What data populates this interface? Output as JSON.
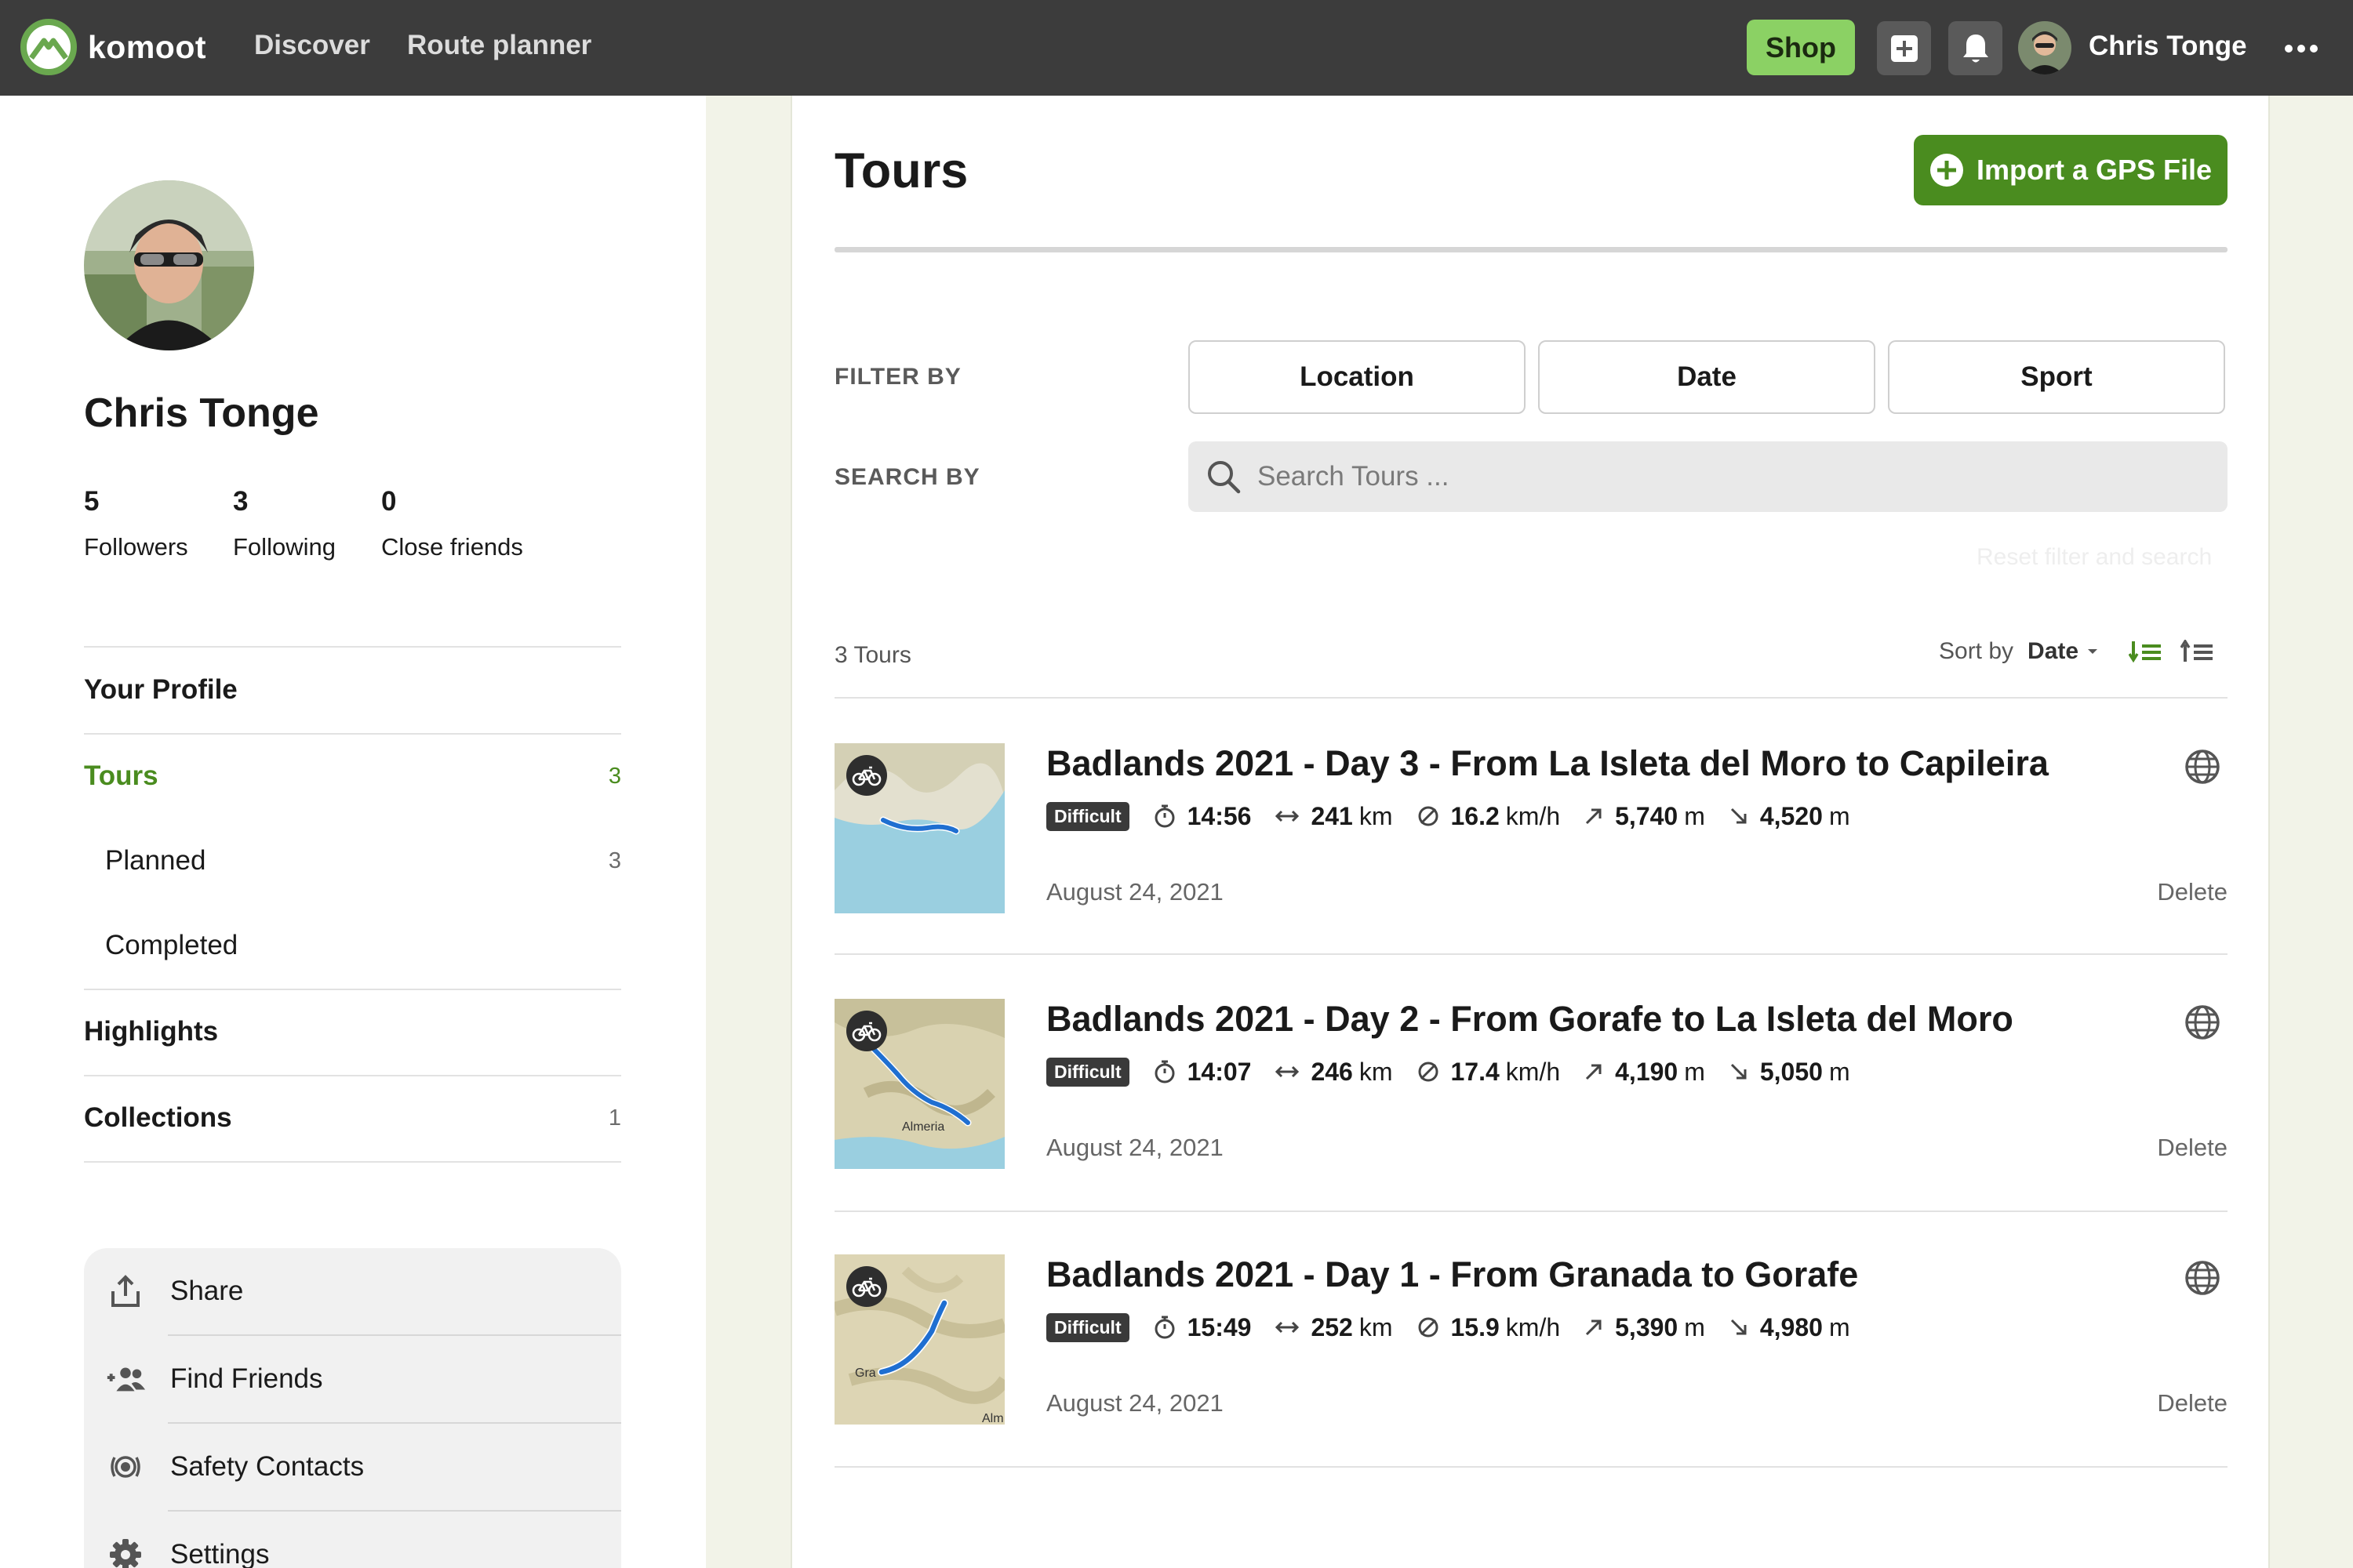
{
  "header": {
    "brand": "komoot",
    "nav": [
      "Discover",
      "Route planner"
    ],
    "shop_label": "Shop",
    "username": "Chris Tonge"
  },
  "profile": {
    "name": "Chris Tonge",
    "stats": [
      {
        "value": "5",
        "label": "Followers"
      },
      {
        "value": "3",
        "label": "Following"
      },
      {
        "value": "0",
        "label": "Close friends"
      }
    ]
  },
  "sidebar": {
    "items": [
      {
        "label": "Your Profile",
        "count": ""
      },
      {
        "label": "Tours",
        "count": "3"
      },
      {
        "label": "Planned",
        "count": "3"
      },
      {
        "label": "Completed",
        "count": ""
      },
      {
        "label": "Highlights",
        "count": ""
      },
      {
        "label": "Collections",
        "count": "1"
      }
    ],
    "actions": [
      "Share",
      "Find Friends",
      "Safety Contacts",
      "Settings"
    ]
  },
  "main": {
    "title": "Tours",
    "import_label": "Import a GPS File",
    "filter_by_label": "FILTER BY",
    "search_by_label": "SEARCH BY",
    "filters": [
      "Location",
      "Date",
      "Sport"
    ],
    "search_placeholder": "Search Tours ...",
    "reset_label": "Reset filter and search",
    "tour_count": "3 Tours",
    "sort_label": "Sort by",
    "sort_value": "Date"
  },
  "tours": [
    {
      "title": "Badlands 2021 - Day 3 - From La Isleta del Moro to Capileira",
      "difficulty": "Difficult",
      "duration": "14:56",
      "distance": "241",
      "distance_unit": "km",
      "speed": "16.2",
      "speed_unit": "km/h",
      "up": "5,740",
      "up_unit": "m",
      "down": "4,520",
      "down_unit": "m",
      "date": "August 24, 2021",
      "delete_label": "Delete",
      "map_label": ""
    },
    {
      "title": "Badlands 2021 - Day 2 - From Gorafe to La Isleta del Moro",
      "difficulty": "Difficult",
      "duration": "14:07",
      "distance": "246",
      "distance_unit": "km",
      "speed": "17.4",
      "speed_unit": "km/h",
      "up": "4,190",
      "up_unit": "m",
      "down": "5,050",
      "down_unit": "m",
      "date": "August 24, 2021",
      "delete_label": "Delete",
      "map_label": "Almeria"
    },
    {
      "title": "Badlands 2021 - Day 1 - From Granada to Gorafe",
      "difficulty": "Difficult",
      "duration": "15:49",
      "distance": "252",
      "distance_unit": "km",
      "speed": "15.9",
      "speed_unit": "km/h",
      "up": "5,390",
      "up_unit": "m",
      "down": "4,980",
      "down_unit": "m",
      "date": "August 24, 2021",
      "delete_label": "Delete",
      "map_label": "Gra",
      "map_label_2": "Alm"
    }
  ],
  "colors": {
    "topbar": "#3c3c3c",
    "accent_green": "#4a8c1f",
    "shop_green": "#8bd164",
    "page_bg": "#f2f3e8"
  },
  "icons": [
    "komoot-logo-icon",
    "plus-square-icon",
    "bell-icon",
    "more-icon",
    "share-icon",
    "add-friend-icon",
    "safety-icon",
    "gear-icon",
    "search-icon",
    "globe-icon",
    "bike-icon",
    "stopwatch-icon",
    "distance-icon",
    "speed-icon",
    "uphill-icon",
    "downhill-icon"
  ]
}
